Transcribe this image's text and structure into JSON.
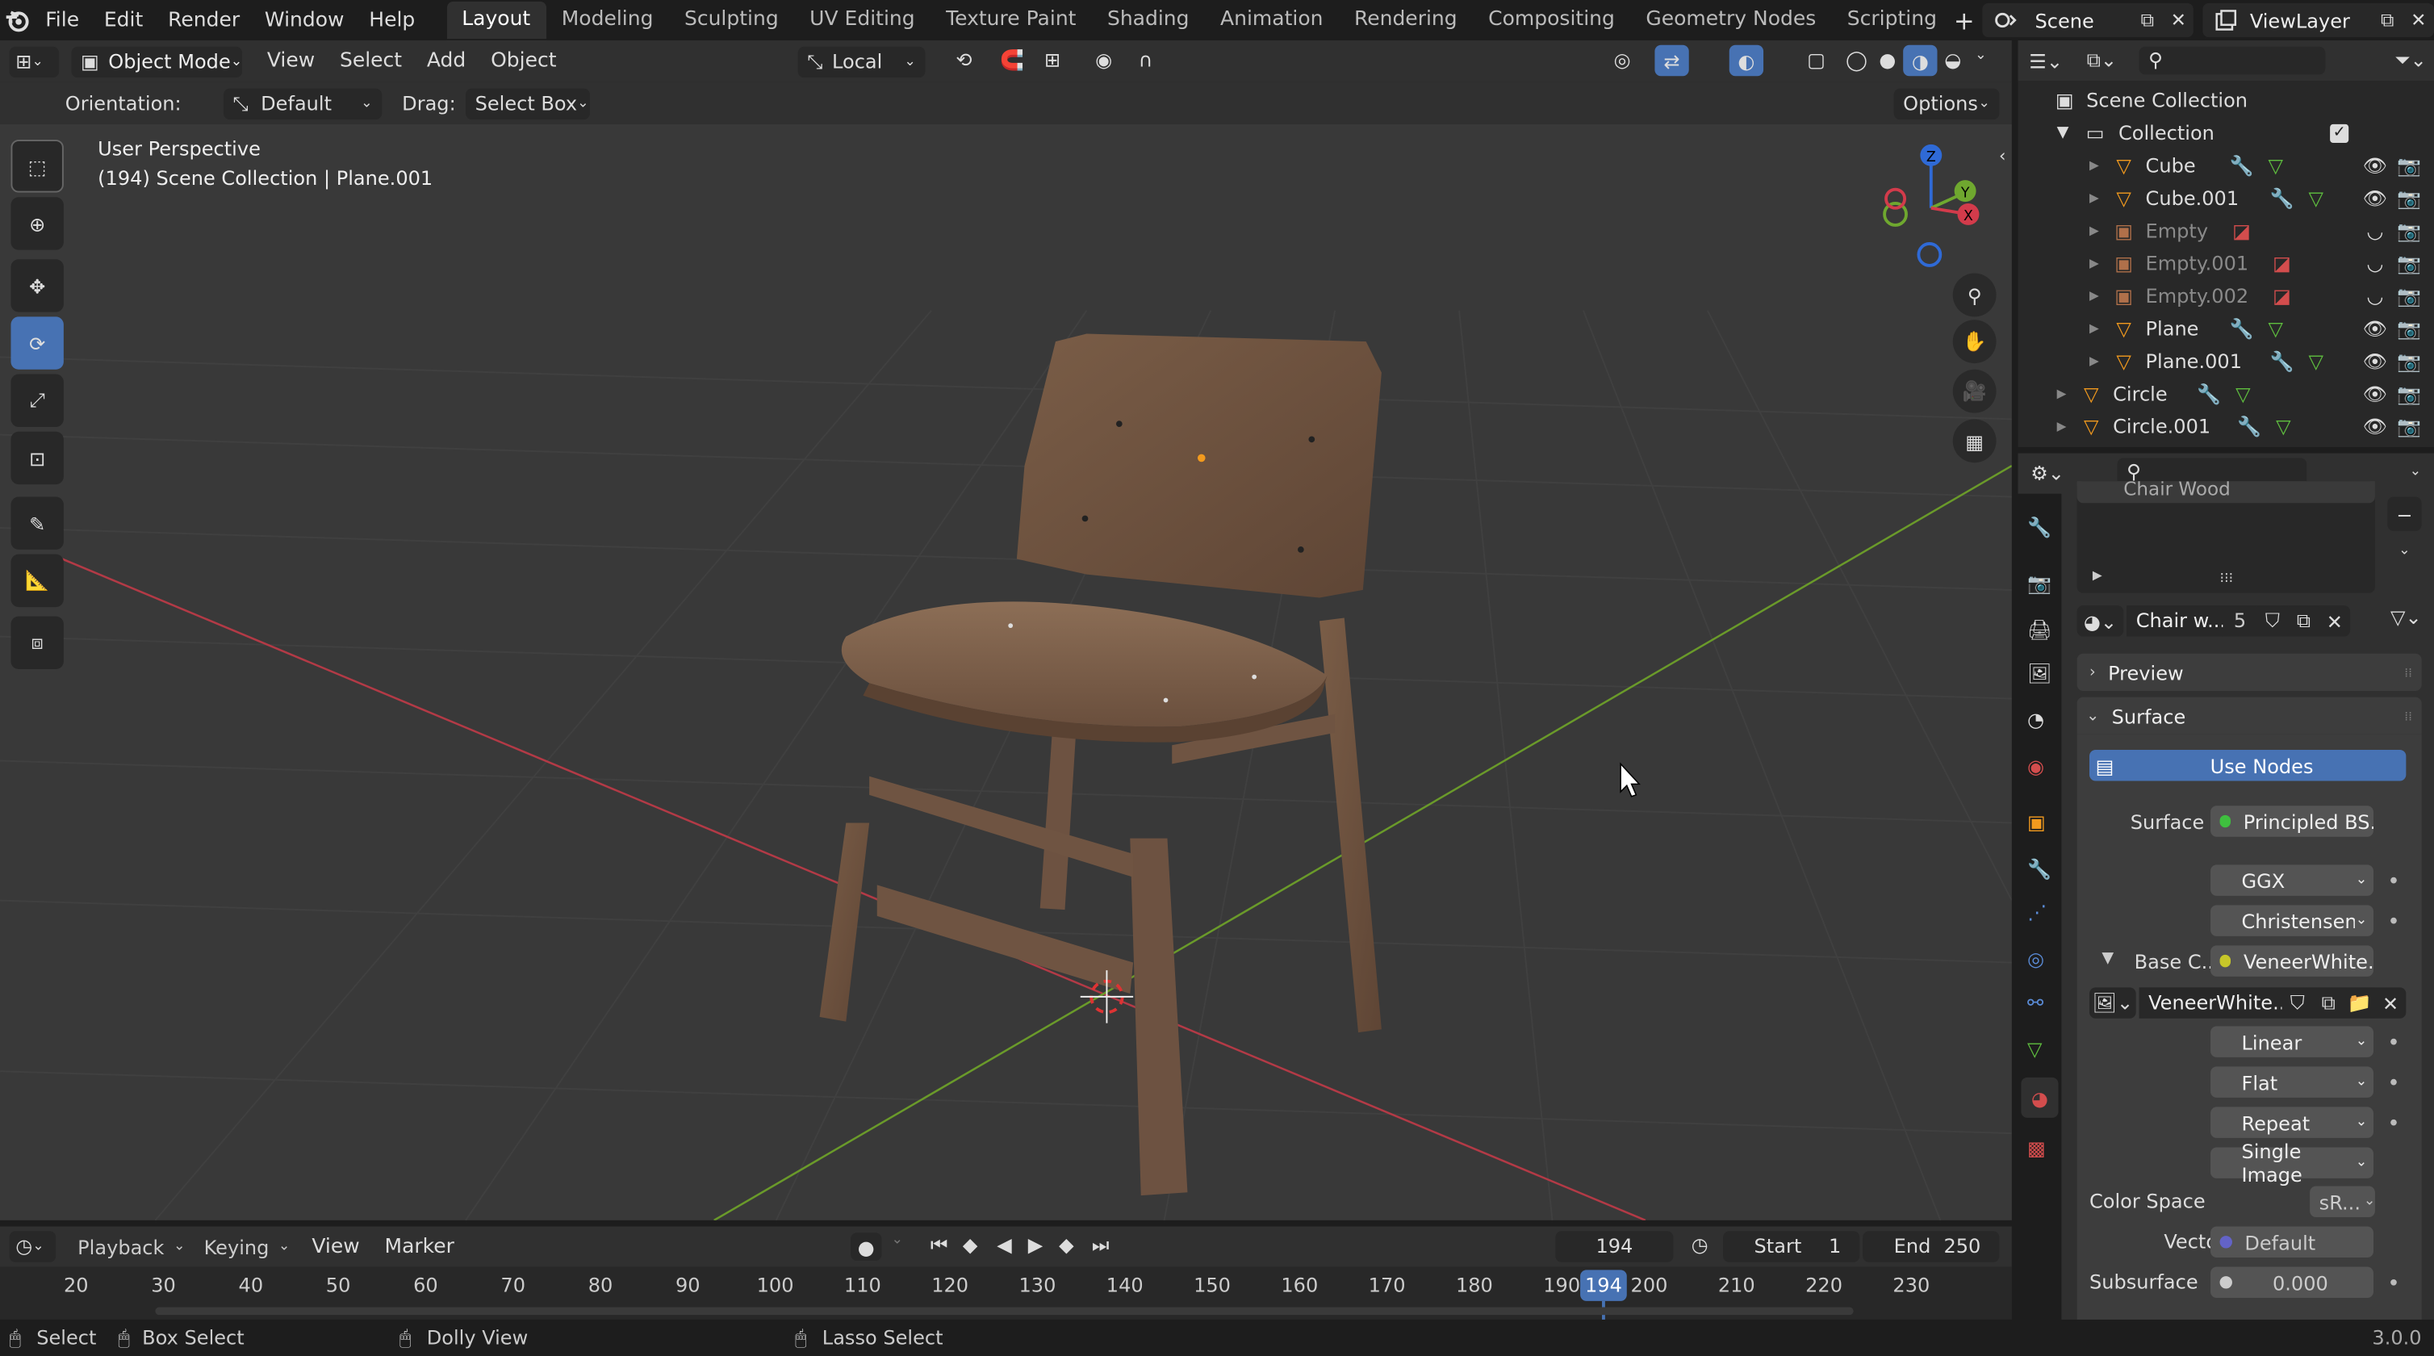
{
  "top_menu": [
    "File",
    "Edit",
    "Render",
    "Window",
    "Help"
  ],
  "workspaces": [
    "Layout",
    "Modeling",
    "Sculpting",
    "UV Editing",
    "Texture Paint",
    "Shading",
    "Animation",
    "Rendering",
    "Compositing",
    "Geometry Nodes",
    "Scripting"
  ],
  "active_workspace": "Layout",
  "scene_name": "Scene",
  "view_layer": "ViewLayer",
  "viewport_header": {
    "mode": "Object Mode",
    "menus": [
      "View",
      "Select",
      "Add",
      "Object"
    ],
    "transform_orientation": "Local"
  },
  "tool_settings": {
    "orientation_label": "Orientation:",
    "orientation_value": "Default",
    "drag_label": "Drag:",
    "drag_value": "Select Box",
    "options": "Options"
  },
  "viewport_info": {
    "line1": "User Perspective",
    "line2": "(194) Scene Collection | Plane.001"
  },
  "gizmo": {
    "z": "Z",
    "y": "Y",
    "x": "X"
  },
  "outliner": {
    "root": "Scene Collection",
    "collection": "Collection",
    "items": [
      {
        "name": "Cube",
        "dim": false
      },
      {
        "name": "Cube.001",
        "dim": false
      },
      {
        "name": "Empty",
        "dim": true
      },
      {
        "name": "Empty.001",
        "dim": true
      },
      {
        "name": "Empty.002",
        "dim": true
      },
      {
        "name": "Plane",
        "dim": false
      },
      {
        "name": "Plane.001",
        "dim": false
      }
    ],
    "top_items": [
      "Circle",
      "Circle.001"
    ]
  },
  "properties": {
    "material_slot": "Chair Wood",
    "material_name": "Chair w...",
    "users": "5",
    "preview": "Preview",
    "surface_panel": "Surface",
    "use_nodes": "Use Nodes",
    "rows": [
      {
        "label": "Surface",
        "value": "Principled BS...",
        "dot": "#3fbf3f"
      },
      {
        "label": "",
        "value": "GGX",
        "dot": ""
      },
      {
        "label": "",
        "value": "Christensen-B...",
        "dot": ""
      },
      {
        "label": "Base C...",
        "value": "VeneerWhite...",
        "dot": "#c7c729"
      }
    ],
    "image_name": "VeneerWhite...",
    "image_rows": [
      "Linear",
      "Flat",
      "Repeat",
      "Single Image"
    ],
    "color_space_label": "Color Space",
    "color_space": "sR...",
    "vector_label": "Vector",
    "vector": "Default",
    "subsurface_label": "Subsurface",
    "subsurface": "0.000"
  },
  "timeline": {
    "menus": [
      "Playback",
      "Keying",
      "View",
      "Marker"
    ],
    "current_frame": "194",
    "start_label": "Start",
    "start": "1",
    "end_label": "End",
    "end": "250",
    "ticks": [
      "20",
      "30",
      "40",
      "50",
      "60",
      "70",
      "80",
      "90",
      "100",
      "110",
      "120",
      "130",
      "140",
      "150",
      "160",
      "170",
      "180",
      "190",
      "200",
      "210",
      "220",
      "230"
    ]
  },
  "statusbar": {
    "select": "Select",
    "box_select": "Box Select",
    "dolly": "Dolly View",
    "lasso": "Lasso Select",
    "version": "3.0.0"
  }
}
